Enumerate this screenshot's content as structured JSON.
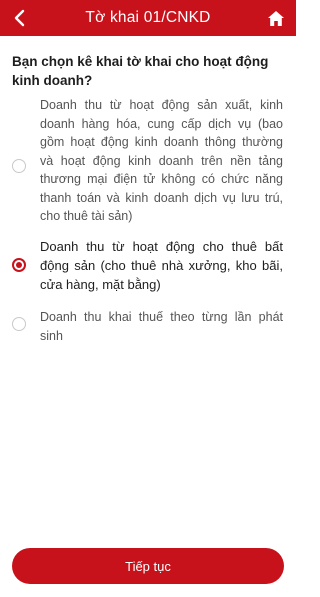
{
  "header": {
    "title": "Tờ khai 01/CNKD",
    "back_icon": "chevron-left-icon",
    "home_icon": "home-icon",
    "color": "#c8121b"
  },
  "question": "Bạn chọn kê khai tờ khai cho hoạt động kinh doanh?",
  "options": [
    {
      "label": "Doanh thu từ hoạt động sản xuất, kinh doanh hàng hóa, cung cấp dịch vụ (bao gồm hoạt động kinh doanh thông thường và hoạt động kinh doanh trên nền tảng thương mại điện tử không có chức năng thanh toán và kinh doanh dịch vụ lưu trú, cho thuê tài sản)",
      "selected": false
    },
    {
      "label": "Doanh thu từ hoạt động cho thuê bất động sản (cho thuê nhà xưởng, kho bãi, cửa hàng, mặt bằng)",
      "selected": true
    },
    {
      "label": "Doanh thu khai thuế theo từng lần phát sinh",
      "selected": false
    }
  ],
  "continue_label": "Tiếp tục"
}
